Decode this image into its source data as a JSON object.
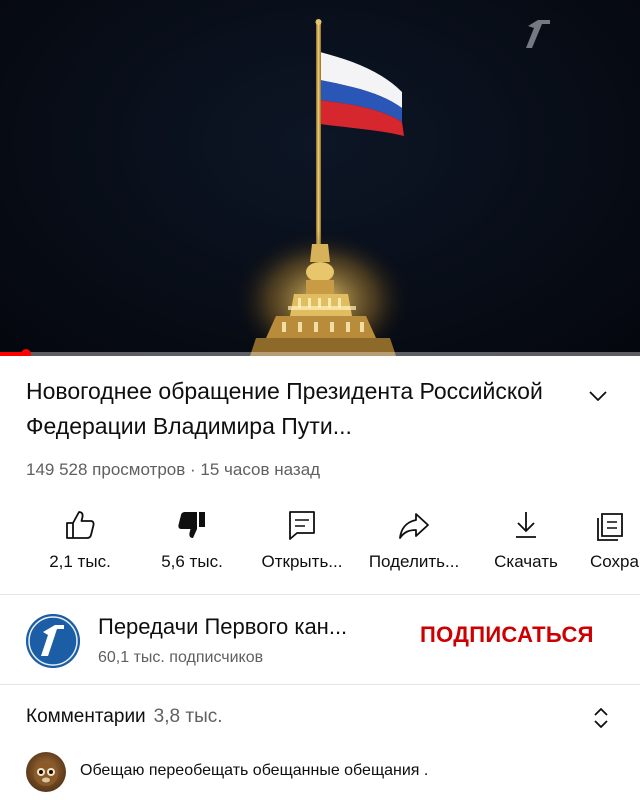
{
  "video": {
    "title": "Новогоднее обращение Президента Российской Федерации Владимира Пути...",
    "views": "149 528 просмотров",
    "age": "15 часов назад",
    "meta_separator": " · ",
    "progress_fraction": 0.04
  },
  "actions": [
    {
      "id": "like",
      "icon": "thumbs-up-icon",
      "label": "2,1 тыс."
    },
    {
      "id": "dislike",
      "icon": "thumbs-down-filled-icon",
      "label": "5,6 тыс."
    },
    {
      "id": "open",
      "icon": "open-chat-icon",
      "label": "Открыть..."
    },
    {
      "id": "share",
      "icon": "share-arrow-icon",
      "label": "Поделить..."
    },
    {
      "id": "download",
      "icon": "download-icon",
      "label": "Скачать"
    },
    {
      "id": "save",
      "icon": "save-playlist-icon",
      "label": "Сохра"
    }
  ],
  "channel": {
    "name": "Передачи Первого кан...",
    "subscribers": "60,1 тыс. подписчиков",
    "subscribe_label": "ПОДПИСАТЬСЯ"
  },
  "comments": {
    "title": "Комментарии",
    "count": "3,8 тыс.",
    "first_comment": "Обещаю переобещать обещанные обещания ."
  },
  "colors": {
    "accent_red": "#cc0000",
    "progress_red": "#ff0000",
    "secondary_text": "#606060",
    "player_bg": "#070b14"
  }
}
